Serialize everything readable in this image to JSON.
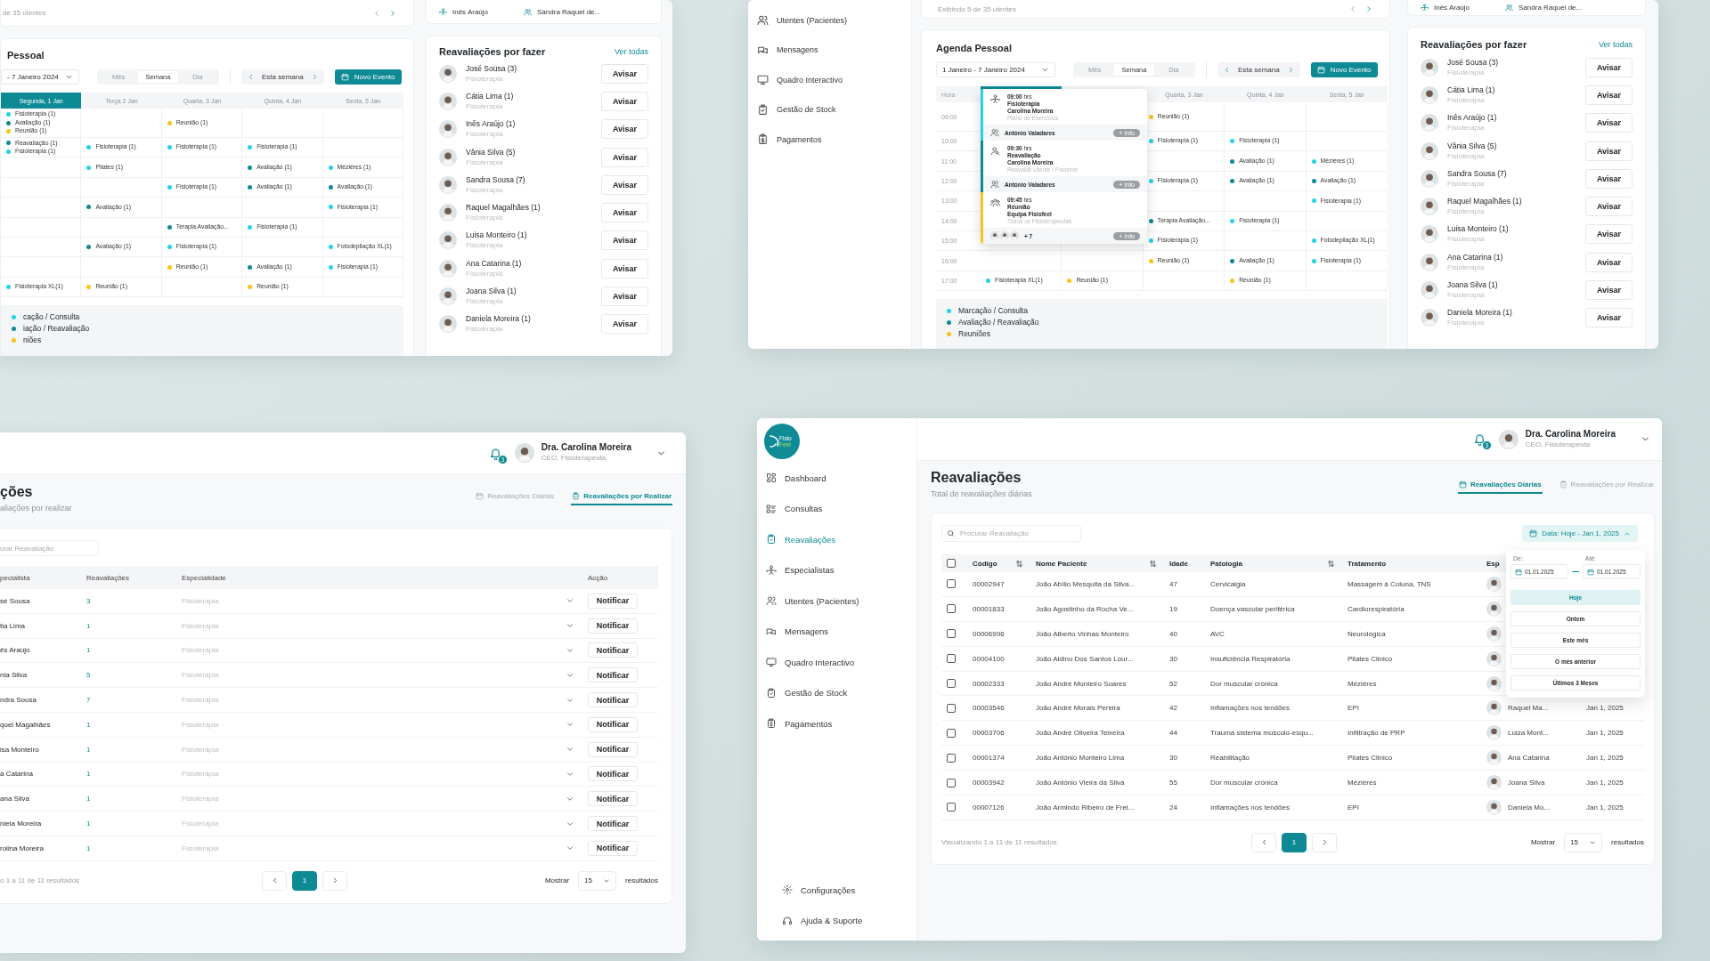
{
  "agenda_window_left": {
    "patients_card": {
      "range_text": "de 35 utentes"
    },
    "specialists_card": {
      "items": [
        "Inês Araújo",
        "Sandra Raquel de..."
      ]
    },
    "agenda": {
      "title": "Pessoal",
      "date_range": "- 7 Janeiro 2024",
      "views": [
        {
          "label": "Mês",
          "selected": false
        },
        {
          "label": "Semana",
          "selected": true
        },
        {
          "label": "Dia",
          "selected": false
        }
      ],
      "week_label": "Esta semana",
      "new_event": "Novo Evento",
      "days": [
        {
          "label": "Segunda, 1 Jan",
          "selected": true
        },
        {
          "label": "Terça 2 Jan",
          "selected": false
        },
        {
          "label": "Quarta, 3 Jan",
          "selected": false
        },
        {
          "label": "Quinta, 4 Jan",
          "selected": false
        },
        {
          "label": "Sexta, 5 Jan",
          "selected": false
        }
      ],
      "rows": [
        {
          "cells": [
            [
              {
                "label": "Fisioterapia (1)",
                "color": "#22d3e6"
              },
              {
                "label": "Avaliação (1)",
                "color": "#0e8a94"
              },
              {
                "label": "Reunião (1)",
                "color": "#f5c518"
              }
            ],
            [],
            [
              {
                "label": "Reunião (1)",
                "color": "#f5c518"
              }
            ],
            [],
            []
          ]
        },
        {
          "cells": [
            [
              {
                "label": "Reavaliação (1)",
                "color": "#0e8a94"
              },
              {
                "label": "Fisioterapia (1)",
                "color": "#22d3e6"
              }
            ],
            [
              {
                "label": "Fisioterapia (1)",
                "color": "#22d3e6"
              }
            ],
            [
              {
                "label": "Fisioterapia (1)",
                "color": "#22d3e6"
              }
            ],
            [
              {
                "label": "Fisioterapia (1)",
                "color": "#22d3e6"
              }
            ],
            []
          ]
        },
        {
          "cells": [
            [],
            [
              {
                "label": "Pilates (1)",
                "color": "#22d3e6"
              }
            ],
            [],
            [
              {
                "label": "Avaliação (1)",
                "color": "#0e8a94"
              }
            ],
            [
              {
                "label": "Mézières (1)",
                "color": "#22d3e6"
              }
            ]
          ]
        },
        {
          "cells": [
            [],
            [],
            [
              {
                "label": "Fisioterapia (1)",
                "color": "#22d3e6"
              }
            ],
            [
              {
                "label": "Avaliação (1)",
                "color": "#0e8a94"
              }
            ],
            [
              {
                "label": "Avaliação (1)",
                "color": "#0e8a94"
              }
            ]
          ]
        },
        {
          "cells": [
            [],
            [
              {
                "label": "Avaliação (1)",
                "color": "#0e8a94"
              }
            ],
            [],
            [],
            [
              {
                "label": "Fisioterapia (1)",
                "color": "#22d3e6"
              }
            ]
          ]
        },
        {
          "cells": [
            [],
            [],
            [
              {
                "label": "Terapia Avaliação...",
                "color": "#0e8a94"
              }
            ],
            [
              {
                "label": "Fisioterapia (1)",
                "color": "#22d3e6"
              }
            ],
            []
          ]
        },
        {
          "cells": [
            [],
            [
              {
                "label": "Avaliação (1)",
                "color": "#0e8a94"
              }
            ],
            [
              {
                "label": "Fisioterapia (1)",
                "color": "#22d3e6"
              }
            ],
            [],
            [
              {
                "label": "Fotodepilação XL(1)",
                "color": "#22d3e6"
              }
            ]
          ]
        },
        {
          "cells": [
            [],
            [],
            [
              {
                "label": "Reunião (1)",
                "color": "#f5c518"
              }
            ],
            [
              {
                "label": "Avaliação (1)",
                "color": "#0e8a94"
              }
            ],
            [
              {
                "label": "Fisioterapia (1)",
                "color": "#22d3e6"
              }
            ]
          ]
        },
        {
          "cells": [
            [
              {
                "label": "Fisioterapia XL(1)",
                "color": "#22d3e6"
              }
            ],
            [
              {
                "label": "Reunião (1)",
                "color": "#f5c518"
              }
            ],
            [],
            [
              {
                "label": "Reunião (1)",
                "color": "#f5c518"
              }
            ],
            []
          ]
        }
      ],
      "legend": [
        {
          "label": "cação / Consulta",
          "color": "#22d3e6"
        },
        {
          "label": "iação / Reavaliação",
          "color": "#0e8a94"
        },
        {
          "label": "niões",
          "color": "#f5c518"
        }
      ]
    },
    "reassessments": {
      "title": "Reavaliações por fazer",
      "see_all": "Ver todas",
      "items": [
        {
          "name": "José Sousa (3)",
          "specialty": "Fisioterapia",
          "action": "Avisar"
        },
        {
          "name": "Cátia Lima (1)",
          "specialty": "Fisioterapia",
          "action": "Avisar"
        },
        {
          "name": "Inês Araújo (1)",
          "specialty": "Fisioterapia",
          "action": "Avisar"
        },
        {
          "name": "Vânia Silva (5)",
          "specialty": "Fisioterapia",
          "action": "Avisar"
        },
        {
          "name": "Sandra Sousa (7)",
          "specialty": "Fisioterapia",
          "action": "Avisar"
        },
        {
          "name": "Raquel Magalhães (1)",
          "specialty": "Fisioterapia",
          "action": "Avisar"
        },
        {
          "name": "Luisa Monteiro (1)",
          "specialty": "Fisioterapia",
          "action": "Avisar"
        },
        {
          "name": "Ana Catarina (1)",
          "specialty": "Fisioterapia",
          "action": "Avisar"
        },
        {
          "name": "Joana Silva (1)",
          "specialty": "Fisioterapia",
          "action": "Avisar"
        },
        {
          "name": "Daniela Moreira (1)",
          "specialty": "Fisioterapia",
          "action": "Avisar"
        }
      ]
    }
  },
  "agenda_window_right": {
    "sidebar": {
      "items": [
        {
          "label": "Utentes (Pacientes)",
          "selected": false
        },
        {
          "label": "Mensagens",
          "selected": false
        },
        {
          "label": "Quadro Interactivo",
          "selected": false
        },
        {
          "label": "Gestão de Stock",
          "selected": false
        },
        {
          "label": "Pagamentos",
          "selected": false
        }
      ]
    },
    "patients_card": {
      "range_text": "Exibindo 5 de 35 utentes"
    },
    "specialists_card": {
      "items": [
        "Inês Araújo",
        "Sandra Raquel de..."
      ]
    },
    "agenda": {
      "title": "Agenda Pessoal",
      "date_range": "1 Janeiro - 7 Janeiro 2024",
      "views": [
        {
          "label": "Mês",
          "selected": false
        },
        {
          "label": "Semana",
          "selected": true
        },
        {
          "label": "Dia",
          "selected": false
        }
      ],
      "week_label": "Esta semana",
      "new_event": "Novo Evento",
      "hour_label": "Hora",
      "days": [
        {
          "selected": true
        },
        {
          "selected": false
        },
        {
          "label": "Quarta, 3 Jan",
          "selected": false
        },
        {
          "label": "Quinta, 4 Jan",
          "selected": false
        },
        {
          "label": "Sexta, 5 Jan",
          "selected": false
        }
      ],
      "rows": [
        {
          "hour": "09:00",
          "cells": [
            [],
            [],
            [
              {
                "label": "Reunião (1)",
                "color": "#f5c518"
              }
            ],
            [],
            []
          ]
        },
        {
          "hour": "10:00",
          "cells": [
            [],
            [],
            [
              {
                "label": "Fisioterapia (1)",
                "color": "#22d3e6"
              }
            ],
            [
              {
                "label": "Fisioterapia (1)",
                "color": "#22d3e6"
              }
            ],
            []
          ]
        },
        {
          "hour": "11:00",
          "cells": [
            [],
            [],
            [],
            [
              {
                "label": "Avaliação (1)",
                "color": "#0e8a94"
              }
            ],
            [
              {
                "label": "Mézières (1)",
                "color": "#22d3e6"
              }
            ]
          ]
        },
        {
          "hour": "12:00",
          "cells": [
            [],
            [],
            [
              {
                "label": "Fisioterapia (1)",
                "color": "#22d3e6"
              }
            ],
            [
              {
                "label": "Avaliação (1)",
                "color": "#0e8a94"
              }
            ],
            [
              {
                "label": "Avaliação (1)",
                "color": "#0e8a94"
              }
            ]
          ]
        },
        {
          "hour": "13:00",
          "cells": [
            [],
            [],
            [],
            [],
            [
              {
                "label": "Fisioterapia (1)",
                "color": "#22d3e6"
              }
            ]
          ]
        },
        {
          "hour": "14:00",
          "cells": [
            [],
            [],
            [
              {
                "label": "Terapia Avaliação...",
                "color": "#0e8a94"
              }
            ],
            [
              {
                "label": "Fisioterapia (1)",
                "color": "#22d3e6"
              }
            ],
            []
          ]
        },
        {
          "hour": "15:00",
          "cells": [
            [],
            [],
            [
              {
                "label": "Fisioterapia (1)",
                "color": "#22d3e6"
              }
            ],
            [],
            [
              {
                "label": "Fotodepilação XL(1)",
                "color": "#22d3e6"
              }
            ]
          ]
        },
        {
          "hour": "16:00",
          "cells": [
            [],
            [],
            [
              {
                "label": "Reunião (1)",
                "color": "#f5c518"
              }
            ],
            [
              {
                "label": "Avaliação (1)",
                "color": "#0e8a94"
              }
            ],
            [
              {
                "label": "Fisioterapia (1)",
                "color": "#22d3e6"
              }
            ]
          ]
        },
        {
          "hour": "17:00",
          "cells": [
            [
              {
                "label": "Fisioterapia XL(1)",
                "color": "#22d3e6"
              }
            ],
            [
              {
                "label": "Reunião (1)",
                "color": "#f5c518"
              }
            ],
            [],
            [
              {
                "label": "Reunião (1)",
                "color": "#f5c518"
              }
            ],
            []
          ]
        }
      ],
      "day_popup": {
        "entries": [
          {
            "kind": "participant",
            "time": "09:00",
            "unit": "hrs",
            "title": "Fisioterapia",
            "person": "Carolina Moreira",
            "note": "Plano de Exercícios",
            "color": "#22d3e6",
            "participant": "António Valadares",
            "info": "+ Info"
          },
          {
            "kind": "participant",
            "time": "09:30",
            "unit": "hrs",
            "title": "Reavaliação",
            "person": "Carolina Moreira",
            "note": "Reavaliar Utente / Paciente",
            "color": "#0e8a94",
            "participant": "António Valadares",
            "info": "+ Info"
          },
          {
            "kind": "group",
            "time": "09:45",
            "unit": "hrs",
            "title": "Reunião",
            "person": "Equipa Fisiofeel",
            "note": "Todos os Fisioterapeutas",
            "color": "#f5c518",
            "extra": "+ 7",
            "info": "+ Info"
          }
        ]
      },
      "legend": [
        {
          "label": "Marcação / Consulta",
          "color": "#22d3e6"
        },
        {
          "label": "Avaliação / Reavaliação",
          "color": "#0e8a94"
        },
        {
          "label": "Reuniões",
          "color": "#f5c518"
        }
      ]
    },
    "reassessments": {
      "title": "Reavaliações por fazer",
      "see_all": "Ver todas",
      "items": [
        {
          "name": "José Sousa (3)",
          "specialty": "Fisioterapia",
          "action": "Avisar"
        },
        {
          "name": "Cátia Lima (1)",
          "specialty": "Fisioterapia",
          "action": "Avisar"
        },
        {
          "name": "Inês Araújo (1)",
          "specialty": "Fisioterapia",
          "action": "Avisar"
        },
        {
          "name": "Vânia Silva (5)",
          "specialty": "Fisioterapia",
          "action": "Avisar"
        },
        {
          "name": "Sandra Sousa (7)",
          "specialty": "Fisioterapia",
          "action": "Avisar"
        },
        {
          "name": "Raquel Magalhães (1)",
          "specialty": "Fisioterapia",
          "action": "Avisar"
        },
        {
          "name": "Luisa Monteiro (1)",
          "specialty": "Fisioterapia",
          "action": "Avisar"
        },
        {
          "name": "Ana Catarina (1)",
          "specialty": "Fisioterapia",
          "action": "Avisar"
        },
        {
          "name": "Joana Silva (1)",
          "specialty": "Fisioterapia",
          "action": "Avisar"
        },
        {
          "name": "Daniela Moreira (1)",
          "specialty": "Fisioterapia",
          "action": "Avisar"
        }
      ]
    }
  },
  "pending_window": {
    "header": {
      "notifications": "3",
      "user_name": "Dra. Carolina Moreira",
      "user_role": "CEO, Fisioterapeuta"
    },
    "title": "ções",
    "subtitle": "aliações por realizar",
    "tabs": [
      {
        "label": "Reavaliações Diárias",
        "selected": false
      },
      {
        "label": "Reavaliações por Realizar",
        "selected": true
      }
    ],
    "search": {
      "placeholder": "urar Reavaliação"
    },
    "columns": [
      "pecialista",
      "Reavaliações",
      "Especialidade",
      "Acção"
    ],
    "rows": [
      {
        "specialist": "sé Sousa",
        "count": "3",
        "specialty": "Fisioterapia",
        "expanded": false,
        "action": "Notificar"
      },
      {
        "specialist": "tia Lima",
        "count": "1",
        "specialty": "Fisioterapia",
        "expanded": false,
        "action": "Notificar"
      },
      {
        "specialist": "ês Araújo",
        "count": "1",
        "specialty": "Fisioterapia",
        "expanded": false,
        "action": "Notificar"
      },
      {
        "specialist": "nia Silva",
        "count": "5",
        "specialty": "Fisioterapia",
        "expanded": false,
        "action": "Notificar"
      },
      {
        "specialist": "ndra Sousa",
        "count": "7",
        "specialty": "Fisioterapia",
        "expanded": false,
        "action": "Notificar"
      },
      {
        "specialist": "quel Magalhães",
        "count": "1",
        "specialty": "Fisioterapia",
        "expanded": false,
        "action": "Notificar"
      },
      {
        "specialist": "isa Monteiro",
        "count": "1",
        "specialty": "Fisioterapia",
        "expanded": false,
        "action": "Notificar"
      },
      {
        "specialist": "a Catarina",
        "count": "1",
        "specialty": "Fisioterapia",
        "expanded": false,
        "action": "Notificar"
      },
      {
        "specialist": "ana Silva",
        "count": "1",
        "specialty": "Fisioterapia",
        "expanded": false,
        "action": "Notificar"
      },
      {
        "specialist": "niela Moreira",
        "count": "1",
        "specialty": "Fisioterapia",
        "expanded": false,
        "action": "Notificar"
      },
      {
        "specialist": "rolina Moreira",
        "count": "1",
        "specialty": "Fisioterapia",
        "expanded": false,
        "action": "Notificar"
      }
    ],
    "footer": {
      "summary": "o 1 a 11 de 11 resultados",
      "pages": [
        {
          "label": "1",
          "selected": true
        }
      ],
      "show_label": "Mostrar",
      "page_size": "15",
      "results_label": "resultados"
    }
  },
  "daily_window": {
    "logo": {
      "lines": [
        "Fisio",
        "Feel"
      ]
    },
    "sidebar": {
      "items": [
        {
          "label": "Dashboard",
          "selected": false
        },
        {
          "label": "Consultas",
          "selected": false
        },
        {
          "label": "Reavaliações",
          "selected": true
        },
        {
          "label": "Especialistas",
          "selected": false
        },
        {
          "label": "Utentes (Pacientes)",
          "selected": false
        },
        {
          "label": "Mensagens",
          "selected": false
        },
        {
          "label": "Quadro Interactivo",
          "selected": false
        },
        {
          "label": "Gestão de Stock",
          "selected": false
        },
        {
          "label": "Pagamentos",
          "selected": false
        }
      ],
      "footer_items": [
        "Configurações",
        "Ajuda & Suporte"
      ]
    },
    "header": {
      "notifications": "3",
      "user_name": "Dra. Carolina Moreira",
      "user_role": "CEO, Fisioterapeuta"
    },
    "title": "Reavaliações",
    "subtitle": "Total de reavaliações diárias",
    "tabs": [
      {
        "label": "Reavaliações Diárias",
        "selected": true
      },
      {
        "label": "Reavaliações por Realizar",
        "selected": false
      }
    ],
    "search": {
      "placeholder": "Procurar Reavaliação"
    },
    "date_filter": {
      "label": "Data: Hoje - Jan 1, 2025",
      "expanded": true
    },
    "select_all": {
      "checked": false
    },
    "columns": [
      {
        "label": "Código",
        "sortable": true
      },
      {
        "label": "Nome Paciente",
        "sortable": true
      },
      {
        "label": "Idade",
        "sortable": false
      },
      {
        "label": "Patologia",
        "sortable": true
      },
      {
        "label": "Tratamento",
        "sortable": false
      },
      {
        "label": "Esp",
        "sortable": false
      }
    ],
    "rows": [
      {
        "checked": false,
        "code": "00002947",
        "patient": "João Abílio Mesquita da Silva...",
        "age": "47",
        "pathology": "Cervicalgia",
        "treatment": "Massagem à Coluna, TNS"
      },
      {
        "checked": false,
        "code": "00001833",
        "patient": "João Agostinho da Rocha Ve...",
        "age": "19",
        "pathology": "Doença vascular periférica",
        "treatment": "Cardiorespiratória"
      },
      {
        "checked": false,
        "code": "00006996",
        "patient": "João Alberto Vinhas Monteiro",
        "age": "40",
        "pathology": "AVC",
        "treatment": "Neurológica"
      },
      {
        "checked": false,
        "code": "00004100",
        "patient": "João Aldino Dos Santos Lour...",
        "age": "30",
        "pathology": "Insuficiência Respiratória",
        "treatment": "Pilates Clinico"
      },
      {
        "checked": false,
        "code": "00002333",
        "patient": "João André Monteiro Soares",
        "age": "52",
        "pathology": "Dor muscular crónica",
        "treatment": "Mézières"
      },
      {
        "checked": false,
        "code": "00003546",
        "patient": "João André Morais Pereira",
        "age": "42",
        "pathology": "Inflamações nos tendões",
        "treatment": "EPI",
        "specialist": "Raquel Ma...",
        "date": "Jan 1, 2025"
      },
      {
        "checked": false,
        "code": "00003706",
        "patient": "João André Oliveira Teixeira",
        "age": "44",
        "pathology": "Trauma sistema músculo-esqu...",
        "treatment": "Infiltração de PRP",
        "specialist": "Luiza Mont...",
        "date": "Jan 1, 2025"
      },
      {
        "checked": false,
        "code": "00001374",
        "patient": "João António Monteiro Lima",
        "age": "30",
        "pathology": "Reabilitação",
        "treatment": "Pilates Clinico",
        "specialist": "Ana Catarina",
        "date": "Jan 1, 2025"
      },
      {
        "checked": false,
        "code": "00003942",
        "patient": "João António Vieira da Silva",
        "age": "55",
        "pathology": "Dor muscular crónica",
        "treatment": "Mézières",
        "specialist": "Joana Silva",
        "date": "Jan 1, 2025"
      },
      {
        "checked": false,
        "code": "00007126",
        "patient": "João Armindo Ribeiro de Frei...",
        "age": "24",
        "pathology": "Inflamações nos tendões",
        "treatment": "EPI",
        "specialist": "Daniela Mo...",
        "date": "Jan 1, 2025"
      }
    ],
    "date_popup": {
      "from_label": "De:",
      "to_label": "Até:",
      "from": "01.01.2025",
      "to": "01.01.2025",
      "options": [
        {
          "label": "Hoje",
          "selected": true
        },
        {
          "label": "Ontem",
          "selected": false
        },
        {
          "label": "Este mês",
          "selected": false
        },
        {
          "label": "O mês anterior",
          "selected": false
        },
        {
          "label": "Últimos 3 Meses",
          "selected": false
        }
      ]
    },
    "footer": {
      "summary": "Visualizando 1 a 11 de 11 resultados",
      "pages": [
        {
          "label": "1",
          "selected": true
        }
      ],
      "show_label": "Mostrar",
      "page_size": "15",
      "results_label": "resultados"
    }
  }
}
